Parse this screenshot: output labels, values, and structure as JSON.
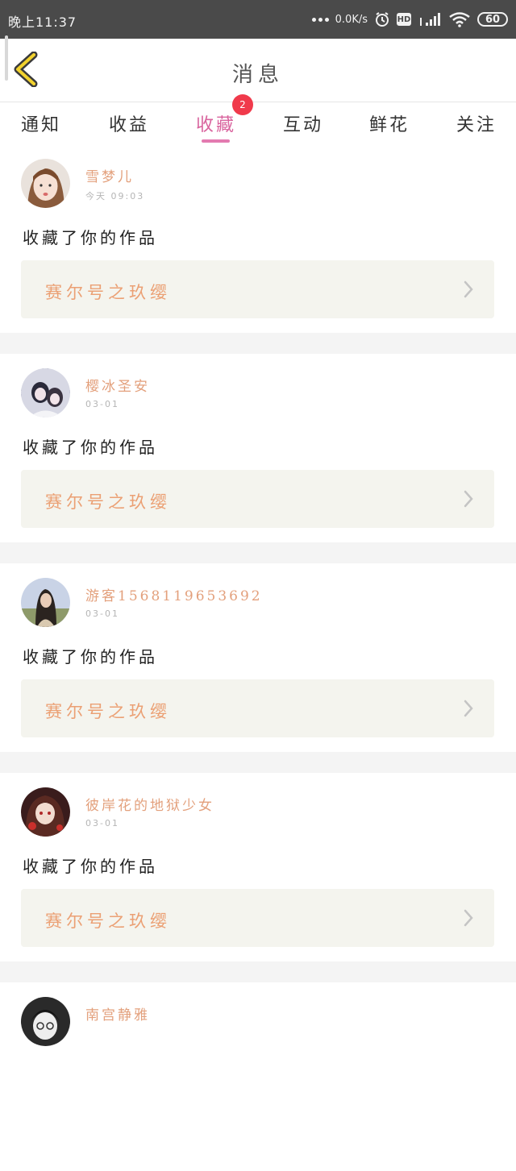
{
  "status_bar": {
    "time": "晚上11:37",
    "net_speed": "0.0K/s",
    "battery": "60"
  },
  "header": {
    "title": "消息"
  },
  "tabs": [
    {
      "label": "通知"
    },
    {
      "label": "收益"
    },
    {
      "label": "收藏",
      "active": true,
      "badge": "2"
    },
    {
      "label": "互动"
    },
    {
      "label": "鲜花"
    },
    {
      "label": "关注"
    }
  ],
  "notifications": [
    {
      "user": "雪梦儿",
      "time": "今天 09:03",
      "action": "收藏了你的作品",
      "work": "赛尔号之玖缨",
      "avatar": "avatar-girl-1"
    },
    {
      "user": "樱冰圣安",
      "time": "03-01",
      "action": "收藏了你的作品",
      "work": "赛尔号之玖缨",
      "avatar": "avatar-couple"
    },
    {
      "user": "游客1568119653692",
      "time": "03-01",
      "action": "收藏了你的作品",
      "work": "赛尔号之玖缨",
      "avatar": "avatar-long-hair"
    },
    {
      "user": "彼岸花的地狱少女",
      "time": "03-01",
      "action": "收藏了你的作品",
      "work": "赛尔号之玖缨",
      "avatar": "avatar-anime-girl"
    },
    {
      "user": "南宫静雅",
      "time": "",
      "action": "",
      "work": "",
      "avatar": "avatar-anime-glasses"
    }
  ],
  "colors": {
    "accent_pink": "#d9649e",
    "name_orange": "#e3a07c",
    "work_orange": "#eba074",
    "badge_red": "#f03a4b",
    "back_yellow": "#f2d22e"
  }
}
